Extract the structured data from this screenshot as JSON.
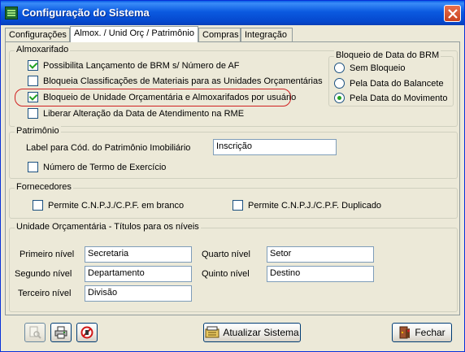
{
  "window": {
    "title": "Configuração do Sistema"
  },
  "tabs": [
    {
      "label": "Configurações",
      "active": false
    },
    {
      "label": "Almox. / Unid Orç / Patrimônio",
      "active": true
    },
    {
      "label": "Compras",
      "active": false
    },
    {
      "label": "Integração",
      "active": false
    }
  ],
  "almoxarifado": {
    "title": "Almoxarifado",
    "options": [
      {
        "label": "Possibilita Lançamento de BRM s/ Número de AF",
        "checked": true
      },
      {
        "label": "Bloqueia Classificações de Materiais para as Unidades Orçamentárias",
        "checked": false
      },
      {
        "label": "Bloqueio de Unidade Orçamentária e Almoxarifados por usuário",
        "checked": true
      },
      {
        "label": "Liberar Alteração da Data de Atendimento na RME",
        "checked": false
      }
    ],
    "bloqueio": {
      "title": "Bloqueio de Data do BRM",
      "options": [
        {
          "label": "Sem Bloqueio",
          "checked": false
        },
        {
          "label": "Pela Data do Balancete",
          "checked": false
        },
        {
          "label": "Pela Data do Movimento",
          "checked": true
        }
      ]
    }
  },
  "patrimonio": {
    "title": "Patrimônio",
    "label_field": "Label para Cód. do Patrimônio Imobiliário",
    "label_value": "Inscrição",
    "numero_termo": {
      "label": "Número de Termo de Exercício",
      "checked": false
    }
  },
  "fornecedores": {
    "title": "Fornecedores",
    "options": [
      {
        "label": "Permite C.N.P.J./C.P.F. em branco",
        "checked": false
      },
      {
        "label": "Permite C.N.P.J./C.P.F. Duplicado",
        "checked": false
      }
    ]
  },
  "unidade": {
    "title": "Unidade Orçamentária - Títulos para os níveis",
    "levels": [
      {
        "label": "Primeiro nível",
        "value": "Secretaria"
      },
      {
        "label": "Segundo nível",
        "value": "Departamento"
      },
      {
        "label": "Terceiro nível",
        "value": "Divisão"
      },
      {
        "label": "Quarto nível",
        "value": "Setor"
      },
      {
        "label": "Quinto nível",
        "value": "Destino"
      }
    ]
  },
  "footer": {
    "atualizar": "Atualizar Sistema",
    "fechar": "Fechar"
  },
  "colors": {
    "titlebar": "#0A5FE6",
    "highlight": "#D02020",
    "check": "#21A121"
  }
}
